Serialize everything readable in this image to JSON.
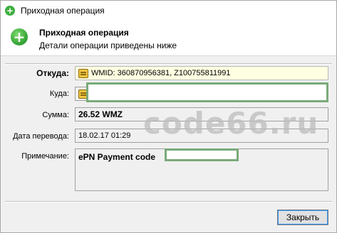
{
  "window": {
    "title": "Приходная операция"
  },
  "header": {
    "title": "Приходная операция",
    "subtitle": "Детали операции приведены ниже"
  },
  "fields": {
    "from_label": "Откуда:",
    "from_value": "WMID: 360870956381, Z100755811991",
    "to_label": "Куда:",
    "to_value": "",
    "amount_label": "Сумма:",
    "amount_value": "26.52 WMZ",
    "date_label": "Дата перевода:",
    "date_value": "18.02.17 01:29",
    "note_label": "Примечание:",
    "note_value": "ePN Payment code"
  },
  "watermark": "code66.ru",
  "buttons": {
    "close_label": "Закрыть"
  },
  "colors": {
    "accent_green": "#3aa83a",
    "redaction_border": "#7aaa7a",
    "highlight_field": "#ffffe1"
  }
}
